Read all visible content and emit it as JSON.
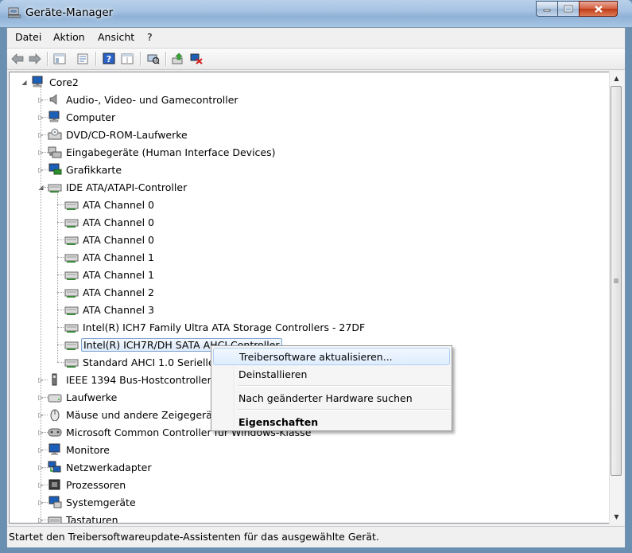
{
  "window": {
    "title": "Geräte-Manager"
  },
  "menubar": {
    "items": [
      "Datei",
      "Aktion",
      "Ansicht",
      "?"
    ]
  },
  "toolbar": {
    "buttons": [
      "back-icon",
      "forward-icon",
      "console-tree-icon",
      "properties-icon",
      "help-icon",
      "view-icon",
      "scan-hardware-icon",
      "update-driver-icon",
      "uninstall-icon"
    ]
  },
  "tree": {
    "root": "Core2",
    "categories": [
      "Audio-, Video- und Gamecontroller",
      "Computer",
      "DVD/CD-ROM-Laufwerke",
      "Eingabegeräte (Human Interface Devices)",
      "Grafikkarte",
      "IDE ATA/ATAPI-Controller",
      "IEEE 1394 Bus-Hostcontroller",
      "Laufwerke",
      "Mäuse und andere Zeigegeräte",
      "Microsoft Common Controller für Windows-Klasse",
      "Monitore",
      "Netzwerkadapter",
      "Prozessoren",
      "Systemgeräte",
      "Tastaturen"
    ],
    "ide_children": [
      "ATA Channel 0",
      "ATA Channel 0",
      "ATA Channel 0",
      "ATA Channel 1",
      "ATA Channel 1",
      "ATA Channel 2",
      "ATA Channel 3",
      "Intel(R) ICH7 Family Ultra ATA Storage Controllers - 27DF",
      "Intel(R) ICH7R/DH SATA AHCI Controller",
      "Standard AHCI 1.0 Serieller ATA-Controller"
    ]
  },
  "context_menu": {
    "items": [
      "Treibersoftware aktualisieren...",
      "Deinstallieren",
      "Nach geänderter Hardware suchen",
      "Eigenschaften"
    ]
  },
  "statusbar": {
    "text": "Startet den Treibersoftwareupdate-Assistenten für das ausgewählte Gerät."
  }
}
